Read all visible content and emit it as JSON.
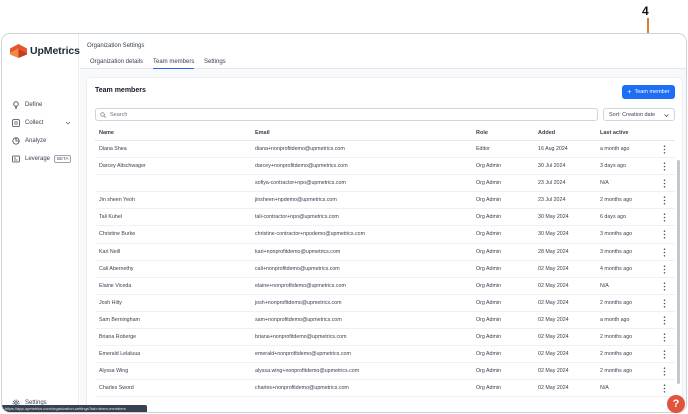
{
  "annotation": {
    "label": "4"
  },
  "app": {
    "name": "UpMetrics"
  },
  "sidebar": {
    "items": [
      {
        "label": "Define",
        "icon": "bulb-icon"
      },
      {
        "label": "Collect",
        "icon": "collect-icon"
      },
      {
        "label": "Analyze",
        "icon": "analyze-icon"
      },
      {
        "label": "Leverage",
        "icon": "leverage-icon",
        "badge": "BETA"
      }
    ],
    "settings_label": "Settings"
  },
  "header": {
    "title": "Organization Settings",
    "tabs": [
      {
        "label": "Organization details"
      },
      {
        "label": "Team members"
      },
      {
        "label": "Settings"
      }
    ]
  },
  "card": {
    "title": "Team members",
    "add_button_label": "Team member",
    "search_placeholder": "Search",
    "sort_label": "Sort: Creation date"
  },
  "table": {
    "columns": [
      "Name",
      "Email",
      "Role",
      "Added",
      "Last active"
    ],
    "rows": [
      {
        "name": "Diana Shea",
        "email": "diana+nonprofitdemo@upmetrics.com",
        "role": "Editor",
        "added": "16 Aug 2024",
        "last": "a month ago"
      },
      {
        "name": "Darcey Altschwager",
        "email": "darcey+nonprofitdemo@upmetrics.com",
        "role": "Org Admin",
        "added": "30 Jul 2024",
        "last": "3 days ago"
      },
      {
        "name": "",
        "email": "sofiya-contractor+npo@upmetrics.com",
        "role": "Org Admin",
        "added": "23 Jul 2024",
        "last": "N/A"
      },
      {
        "name": "Jin sheen Yeoh",
        "email": "jinsheen+npdemo@upmetrics.com",
        "role": "Org Admin",
        "added": "23 Jul 2024",
        "last": "2 months ago"
      },
      {
        "name": "Tali Kuhel",
        "email": "tali-contractor+npo@upmetrics.com",
        "role": "Org Admin",
        "added": "30 May 2024",
        "last": "6 days ago"
      },
      {
        "name": "Christine Burke",
        "email": "christine-contractor+npodemo@upmetrics.com",
        "role": "Org Admin",
        "added": "30 May 2024",
        "last": "3 months ago"
      },
      {
        "name": "Kari Neill",
        "email": "kari+nonprofitdemo@upmetrics.com",
        "role": "Org Admin",
        "added": "28 May 2024",
        "last": "3 months ago"
      },
      {
        "name": "Cali Abernethy",
        "email": "cali+nonprofitdemo@upmetrics.com",
        "role": "Org Admin",
        "added": "02 May 2024",
        "last": "4 months ago"
      },
      {
        "name": "Elaine Viceda",
        "email": "elaine+nonprofitdemo@upmetrics.com",
        "role": "Org Admin",
        "added": "02 May 2024",
        "last": "N/A"
      },
      {
        "name": "Josh Hilty",
        "email": "josh+nonprofitdemo@upmetrics.com",
        "role": "Org Admin",
        "added": "02 May 2024",
        "last": "2 months ago"
      },
      {
        "name": "Sam Berningham",
        "email": "sam+nonprofitdemo@upmetrics.com",
        "role": "Org Admin",
        "added": "02 May 2024",
        "last": "a month ago"
      },
      {
        "name": "Briana Roberge",
        "email": "briana+nonprofitdemo@upmetrics.com",
        "role": "Org Admin",
        "added": "02 May 2024",
        "last": "2 months ago"
      },
      {
        "name": "Emerald Lelaluua",
        "email": "emerald+nonprofitdemo@upmetrics.com",
        "role": "Org Admin",
        "added": "02 May 2024",
        "last": "2 months ago"
      },
      {
        "name": "Alyssa Wing",
        "email": "alyssa.wing+nonprofitdemo@upmetrics.com",
        "role": "Org Admin",
        "added": "02 May 2024",
        "last": "2 months ago"
      },
      {
        "name": "Charles Sword",
        "email": "charles+nonprofitdemo@upmetrics.com",
        "role": "Org Admin",
        "added": "02 May 2024",
        "last": "N/A"
      }
    ]
  },
  "status_url": "https://app.upmetrics.com/organization-settings?tab=team-members",
  "help_label": "?",
  "colors": {
    "accent": "#1d6ef5",
    "brand": "#e8552d",
    "help": "#e0533c",
    "annotation": "#e07a3a"
  }
}
